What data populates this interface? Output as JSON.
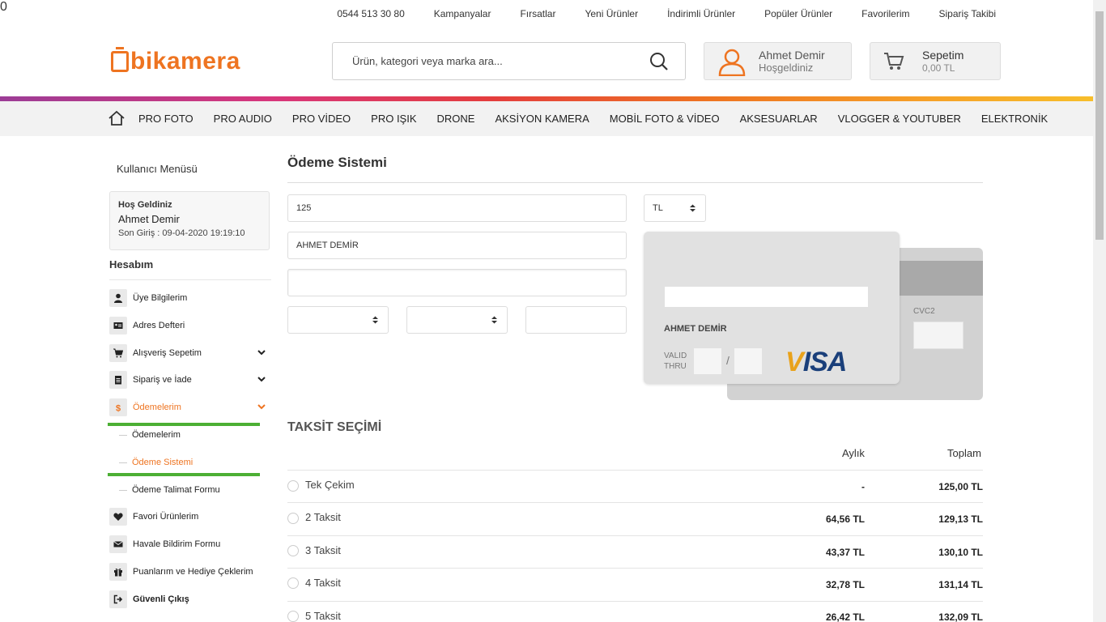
{
  "toplinks": [
    "0544 513 30 80",
    "Kampanyalar",
    "Fırsatlar",
    "Yeni Ürünler",
    "İndirimli Ürünler",
    "Popüler Ürünler",
    "Favorilerim",
    "Sipariş Takibi"
  ],
  "logo": {
    "text": "bikamera"
  },
  "search": {
    "placeholder": "Ürün, kategori veya marka ara..."
  },
  "user": {
    "name": "Ahmet Demir",
    "sub": "Hoşgeldiniz"
  },
  "cart": {
    "title": "Sepetim",
    "amount": "0,00 TL",
    "count": "0"
  },
  "nav": [
    "PRO FOTO",
    "PRO AUDIO",
    "PRO VİDEO",
    "PRO IŞIK",
    "DRONE",
    "AKSİYON KAMERA",
    "MOBİL FOTO & VİDEO",
    "AKSESUARLAR",
    "VLOGGER & YOUTUBER",
    "ELEKTRONİK"
  ],
  "sidebar": {
    "title": "Kullanıcı Menüsü",
    "welcome_label": "Hoş Geldiniz",
    "welcome_name": "Ahmet Demir",
    "last_login": "Son Giriş : 09-04-2020 19:19:10",
    "account_title": "Hesabım",
    "items": [
      {
        "label": "Üye Bilgilerim"
      },
      {
        "label": "Adres Defteri"
      },
      {
        "label": "Alışveriş Sepetim"
      },
      {
        "label": "Sipariş ve İade"
      },
      {
        "label": "Ödemelerim"
      },
      {
        "label": "Favori Ürünlerim"
      },
      {
        "label": "Havale Bildirim Formu"
      },
      {
        "label": "Puanlarım ve Hediye Çeklerim"
      },
      {
        "label": "Güvenli Çıkış"
      }
    ],
    "submenu": [
      {
        "label": "Ödemelerim"
      },
      {
        "label": "Ödeme Sistemi"
      },
      {
        "label": "Ödeme Talimat Formu"
      }
    ]
  },
  "main": {
    "title": "Ödeme Sistemi",
    "amount": "125",
    "currency": "TL",
    "cardholder": "AHMET DEMİR",
    "card_number": "",
    "cvc": ""
  },
  "card": {
    "holder": "AHMET DEMİR",
    "valid_thru": "VALID THRU",
    "slash": "/",
    "cvc_label": "CVC2",
    "brand_v": "V",
    "brand_rest": "ISA"
  },
  "installments": {
    "title": "TAKSİT SEÇİMİ",
    "col_monthly": "Aylık",
    "col_total": "Toplam",
    "rows": [
      {
        "label": "Tek Çekim",
        "monthly": "-",
        "total": "125,00 TL"
      },
      {
        "label": "2 Taksit",
        "monthly": "64,56 TL",
        "total": "129,13 TL"
      },
      {
        "label": "3 Taksit",
        "monthly": "43,37 TL",
        "total": "130,10 TL"
      },
      {
        "label": "4 Taksit",
        "monthly": "32,78 TL",
        "total": "131,14 TL"
      },
      {
        "label": "5 Taksit",
        "monthly": "26,42 TL",
        "total": "132,09 TL"
      }
    ]
  }
}
